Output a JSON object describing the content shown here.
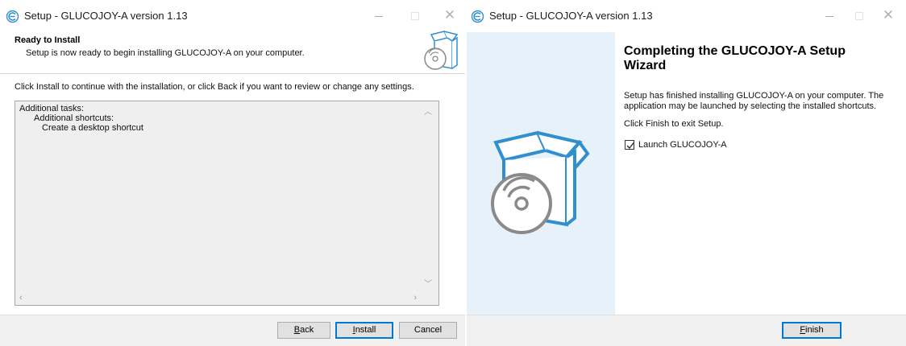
{
  "left_window": {
    "title": "Setup - GLUCOJOY-A version 1.13",
    "heading": "Ready to Install",
    "subheading": "Setup is now ready to begin installing GLUCOJOY-A on your computer.",
    "instruction": "Click Install to continue with the installation, or click Back if you want to review or change any settings.",
    "memo_lines": [
      "Additional tasks:",
      "Additional shortcuts:",
      "Create a desktop shortcut"
    ],
    "buttons": {
      "back": {
        "accel": "B",
        "rest": "ack"
      },
      "install": {
        "accel": "I",
        "rest": "nstall"
      },
      "cancel": "Cancel"
    }
  },
  "right_window": {
    "title": "Setup - GLUCOJOY-A version 1.13",
    "welcome_title": "Completing the GLUCOJOY-A Setup Wizard",
    "finish_text": "Setup has finished installing GLUCOJOY-A on your computer. The application may be launched by selecting the installed shortcuts.",
    "click_finish": "Click Finish to exit Setup.",
    "launch_checkbox": {
      "label": "Launch GLUCOJOY-A",
      "checked": true
    },
    "buttons": {
      "finish": {
        "accel": "F",
        "rest": "inish"
      }
    }
  },
  "colors": {
    "accent": "#0078d7",
    "icon_blue": "#2f8fcf",
    "side_panel": "#e7f1f9",
    "footer": "#f0f0f0"
  },
  "icons": {
    "app": "setup-app-icon",
    "box": "software-box-cd-icon"
  }
}
